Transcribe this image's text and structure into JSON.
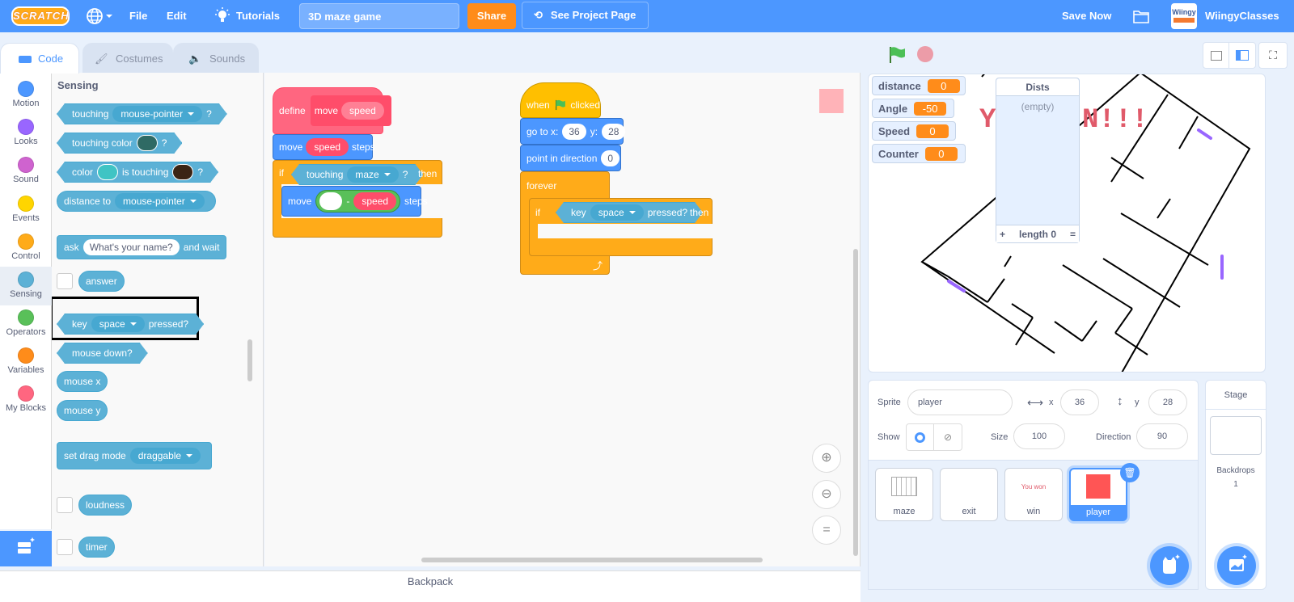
{
  "menubar": {
    "logo": "SCRATCH",
    "file": "File",
    "edit": "Edit",
    "tutorials": "Tutorials",
    "project_title": "3D maze game",
    "share": "Share",
    "see_project_page": "See Project Page",
    "save_now": "Save Now",
    "username": "WiingyClasses",
    "avatar_text": "Wiingy"
  },
  "tabs": [
    {
      "label": "Code",
      "active": true
    },
    {
      "label": "Costumes",
      "active": false
    },
    {
      "label": "Sounds",
      "active": false
    }
  ],
  "categories": [
    {
      "label": "Motion",
      "color": "#4c97ff"
    },
    {
      "label": "Looks",
      "color": "#9966ff"
    },
    {
      "label": "Sound",
      "color": "#cf63cf"
    },
    {
      "label": "Events",
      "color": "#ffd500"
    },
    {
      "label": "Control",
      "color": "#ffab19"
    },
    {
      "label": "Sensing",
      "color": "#5cb1d6",
      "selected": true
    },
    {
      "label": "Operators",
      "color": "#59c059"
    },
    {
      "label": "Variables",
      "color": "#ff8c1a"
    },
    {
      "label": "My Blocks",
      "color": "#ff6680"
    }
  ],
  "palette": {
    "heading": "Sensing",
    "touching": {
      "text": "touching",
      "menu": "mouse-pointer",
      "q": "?"
    },
    "touching_color": {
      "text": "touching color",
      "q": "?",
      "swatch": "#2f6a64"
    },
    "color_touching": {
      "text1": "color",
      "text2": "is touching",
      "q": "?",
      "swatch1": "#3fc4c4",
      "swatch2": "#3b2414"
    },
    "distance_to": {
      "text": "distance to",
      "menu": "mouse-pointer"
    },
    "ask": {
      "text1": "ask",
      "input": "What's your name?",
      "text2": "and wait"
    },
    "answer": "answer",
    "key_pressed": {
      "text1": "key",
      "menu": "space",
      "text2": "pressed?"
    },
    "mouse_down": "mouse down?",
    "mouse_x": "mouse x",
    "mouse_y": "mouse y",
    "drag_mode": {
      "text": "set drag mode",
      "menu": "draggable"
    },
    "loudness": "loudness",
    "timer": "timer"
  },
  "scripts": {
    "define": {
      "define": "define",
      "name": "move",
      "param": "speed"
    },
    "move1": {
      "text1": "move",
      "param": "speed",
      "text2": "steps"
    },
    "if1": {
      "if": "if",
      "touching": "touching",
      "menu": "maze",
      "q": "?",
      "then": "then"
    },
    "move2": {
      "text1": "move",
      "minus": "-",
      "param": "speed",
      "text2": "steps"
    },
    "hat": {
      "when": "when",
      "clicked": "clicked"
    },
    "goto": {
      "text": "go to x:",
      "x": "36",
      "ylabel": "y:",
      "y": "28"
    },
    "point": {
      "text": "point in direction",
      "value": "0"
    },
    "forever": "forever",
    "if2": {
      "if": "if",
      "key": "key",
      "menu": "space",
      "pressed": "pressed?",
      "then": "then"
    }
  },
  "zoom_controls": {
    "zoom_in": "+",
    "zoom_out": "−",
    "reset": "="
  },
  "backpack": "Backpack",
  "stage": {
    "monitors": [
      {
        "label": "distance",
        "value": "0"
      },
      {
        "label": "Angle",
        "value": "-50"
      },
      {
        "label": "Speed",
        "value": "0"
      },
      {
        "label": "Counter",
        "value": "0"
      }
    ],
    "list": {
      "title": "Dists",
      "empty": "(empty)",
      "add": "+",
      "length": "length 0",
      "resize": "="
    },
    "banner_left": "Y",
    "banner_right": "N!!!"
  },
  "sprite_info": {
    "sprite_label": "Sprite",
    "sprite_name": "player",
    "x_label": "x",
    "x": "36",
    "y_label": "y",
    "y": "28",
    "show_label": "Show",
    "size_label": "Size",
    "size": "100",
    "direction_label": "Direction",
    "direction": "90"
  },
  "sprites": [
    {
      "name": "maze",
      "selected": false
    },
    {
      "name": "exit",
      "selected": false
    },
    {
      "name": "win",
      "selected": false,
      "thumb_text": "You won"
    },
    {
      "name": "player",
      "selected": true
    }
  ],
  "stage_panel": {
    "title": "Stage",
    "backdrops_label": "Backdrops",
    "backdrops_count": "1"
  }
}
